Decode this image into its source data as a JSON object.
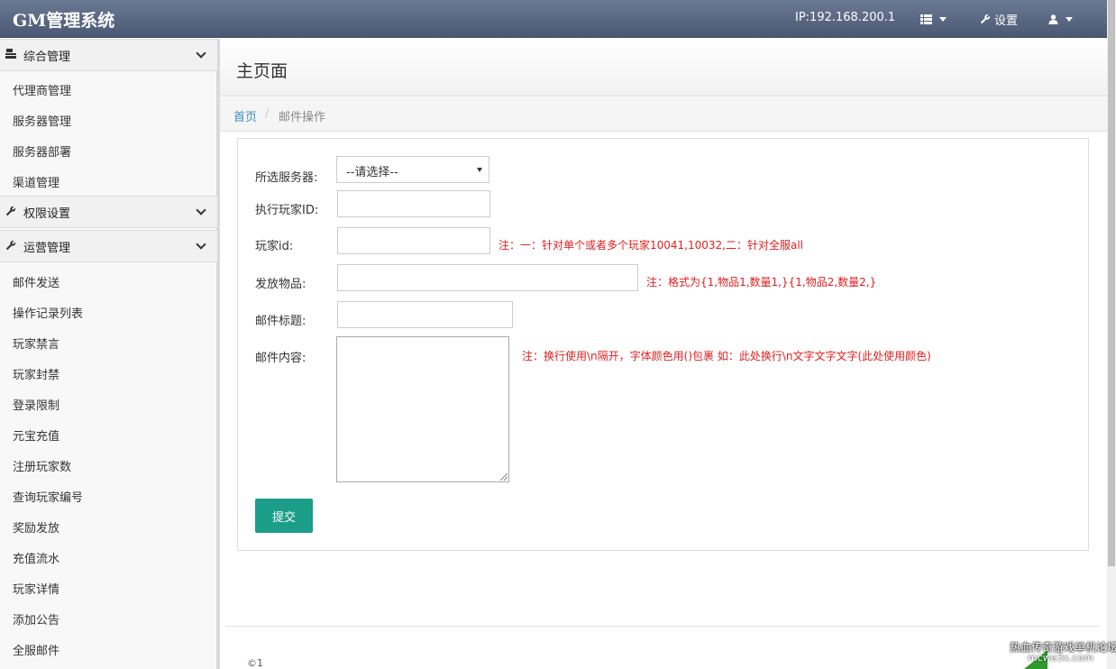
{
  "header": {
    "brand": "GM管理系统",
    "ip": "IP:192.168.200.1",
    "settings_label": "设置",
    "list_icon": "list-icon",
    "user_icon": "user-icon"
  },
  "sidebar": {
    "groups": [
      {
        "label": "综合管理",
        "icon": "server-icon"
      },
      {
        "label": "权限设置",
        "icon": "wrench-icon"
      },
      {
        "label": "运营管理",
        "icon": "wrench-icon"
      }
    ],
    "group1_items": [
      "代理商管理",
      "服务器管理",
      "服务器部署",
      "渠道管理"
    ],
    "group3_items": [
      "邮件发送",
      "操作记录列表",
      "玩家禁言",
      "玩家封禁",
      "登录限制",
      "元宝充值",
      "注册玩家数",
      "查询玩家编号",
      "奖励发放",
      "充值流水",
      "玩家详情",
      "添加公告",
      "全服邮件"
    ]
  },
  "page": {
    "title": "主页面",
    "breadcrumb": {
      "home": "首页",
      "separator": "/",
      "current": "邮件操作"
    }
  },
  "form": {
    "server_label": "所选服务器:",
    "server_selected": "--请选择--",
    "player_id_label": "执行玩家ID:",
    "player_id_value": "",
    "playerid_label": "玩家id:",
    "playerid_value": "",
    "playerid_note": "注：一：针对单个或者多个玩家10041,10032,二：针对全服all",
    "items_label": "发放物品:",
    "items_value": "",
    "items_note": "注：格式为{1,物品1,数量1,}{1,物品2,数量2,}",
    "mail_title_label": "邮件标题:",
    "mail_title_value": "",
    "mail_content_label": "邮件内容:",
    "mail_content_value": "",
    "mail_content_note": "注：换行使用\\n隔开，字体颜色用()包裹 如：此处换行\\n文字文字文字(此处使用颜色)",
    "submit_label": "提交"
  },
  "footer": {
    "copyright": "©1"
  },
  "watermark": {
    "text": "热血传奇游戏单机论坛",
    "sub": "mcwe3x.com"
  },
  "colors": {
    "topbar": "#5a6883",
    "submit": "#1a9e8a",
    "note": "#e02020",
    "link": "#3a8fc1"
  }
}
